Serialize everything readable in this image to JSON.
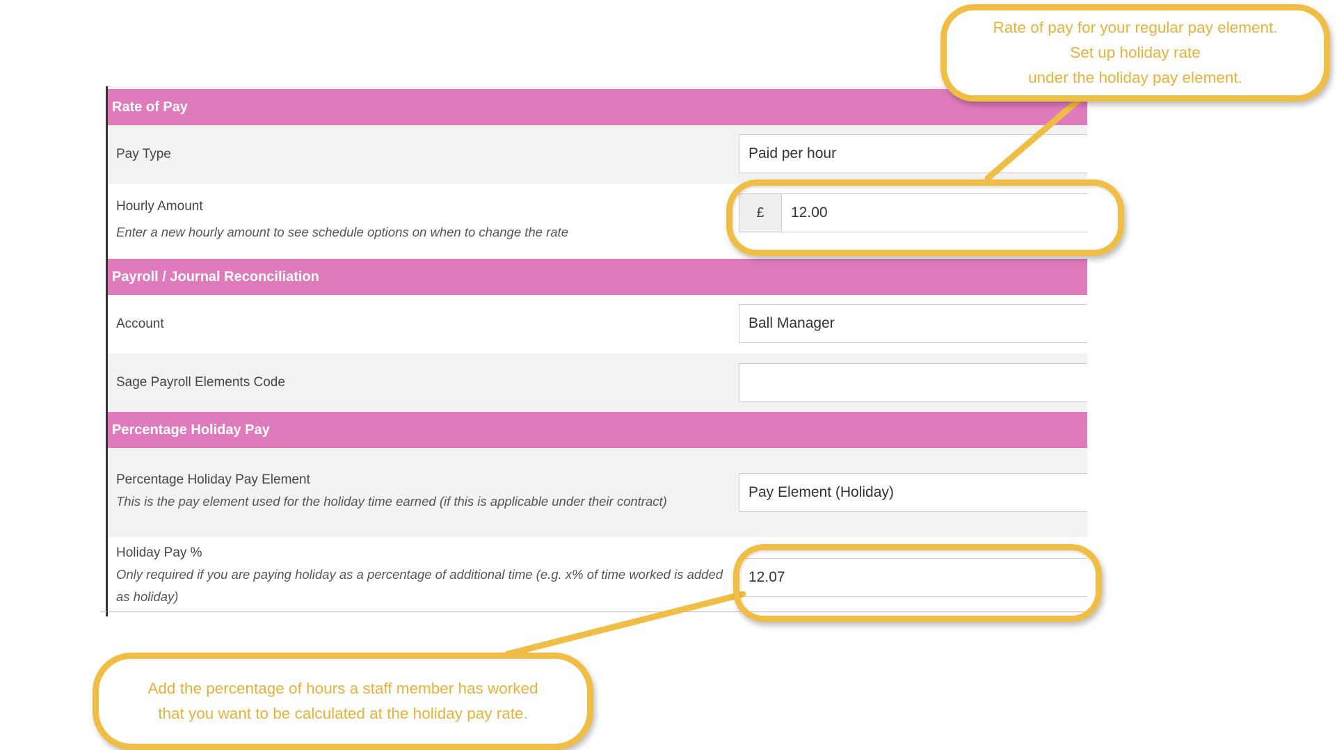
{
  "sections": {
    "rate_of_pay": {
      "title": "Rate of Pay",
      "pay_type": {
        "label": "Pay Type",
        "value": "Paid per hour"
      },
      "hourly_amount": {
        "label": "Hourly Amount",
        "help": "Enter a new hourly amount to see schedule options on when to change the rate",
        "currency": "£",
        "value": "12.00"
      }
    },
    "payroll": {
      "title": "Payroll / Journal Reconciliation",
      "account": {
        "label": "Account",
        "value": "Ball Manager"
      },
      "sage_code": {
        "label": "Sage Payroll Elements Code",
        "value": ""
      }
    },
    "holiday": {
      "title": "Percentage Holiday Pay",
      "element": {
        "label": "Percentage Holiday Pay Element",
        "help": "This is the pay element used for the holiday time earned (if this is applicable under their contract)",
        "value": "Pay Element (Holiday)"
      },
      "percent": {
        "label": "Holiday Pay %",
        "help": "Only required if you are paying holiday as a percentage of additional time (e.g. x% of time worked is added as holiday)",
        "value": "12.07"
      }
    }
  },
  "callouts": {
    "top": [
      "Rate of pay for your regular pay element.",
      "Set up holiday rate",
      "under the holiday pay element."
    ],
    "bottom": [
      "Add the percentage of hours a staff member has worked",
      "that you want to be calculated at the holiday pay rate."
    ]
  },
  "colors": {
    "section_header": "#df7bbd",
    "callout": "#f0bd45",
    "callout_text": "#e8b239"
  }
}
